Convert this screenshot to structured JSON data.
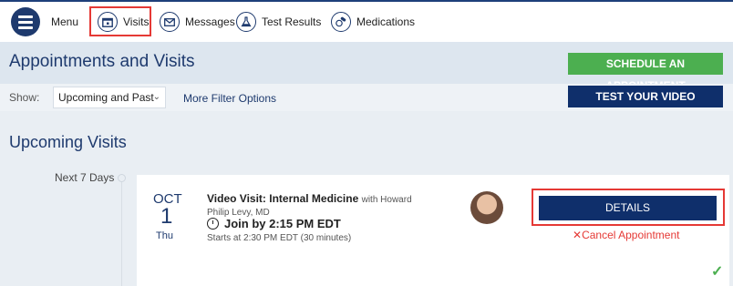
{
  "nav": {
    "menu_label": "Menu",
    "visits_label": "Visits",
    "messages_label": "Messages",
    "test_results_label": "Test Results",
    "medications_label": "Medications"
  },
  "header": {
    "title": "Appointments and Visits",
    "schedule_button": "SCHEDULE AN APPOINTMENT",
    "test_video_button": "TEST YOUR VIDEO"
  },
  "filter": {
    "show_label": "Show:",
    "selected": "Upcoming and Past",
    "more_filter": "More Filter Options"
  },
  "upcoming": {
    "section_title": "Upcoming Visits",
    "group_label": "Next 7 Days",
    "visit": {
      "month": "OCT",
      "day": "1",
      "dow": "Thu",
      "title": "Video Visit: Internal Medicine",
      "with_text": "with Howard Philip Levy, MD",
      "join": "Join by 2:15 PM EDT",
      "starts": "Starts at 2:30 PM EDT (30 minutes)",
      "details_button": "DETAILS",
      "cancel_link": "Cancel Appointment"
    }
  },
  "colors": {
    "accent": "#1e3a6e",
    "green": "#4caf50",
    "highlight": "#e53935"
  }
}
